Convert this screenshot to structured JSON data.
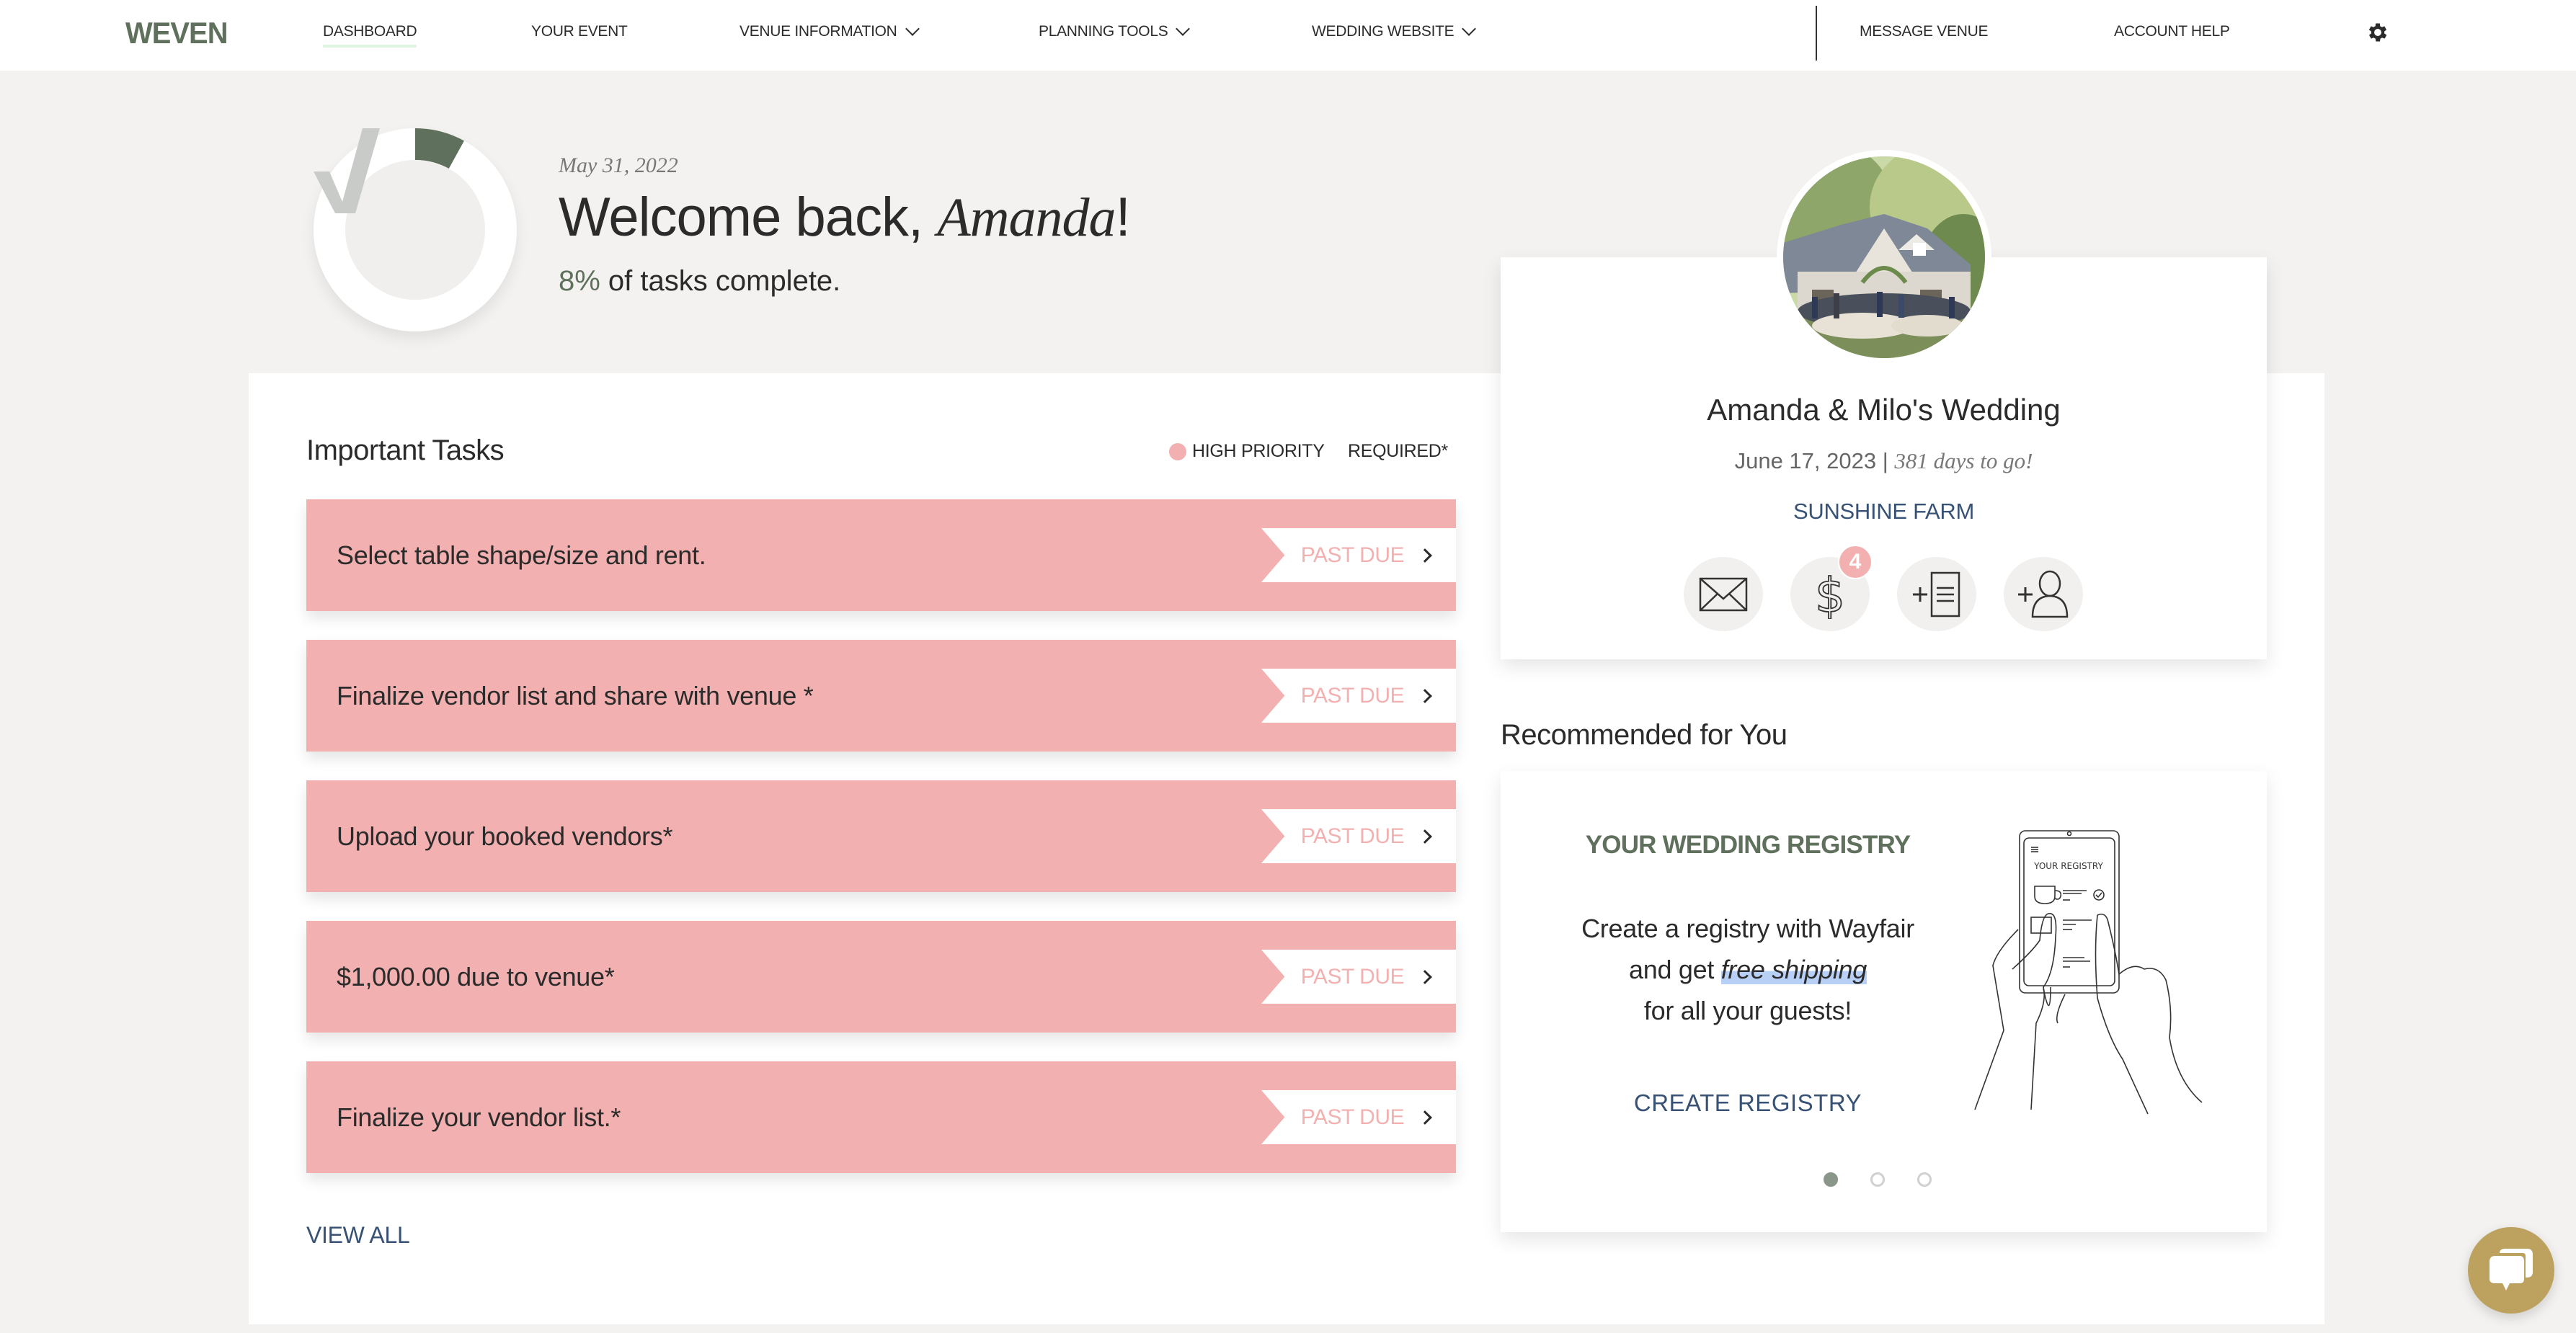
{
  "nav": {
    "logo": "WEVEN",
    "items": [
      {
        "label": "DASHBOARD",
        "active": true,
        "dropdown": false
      },
      {
        "label": "YOUR EVENT",
        "active": false,
        "dropdown": false
      },
      {
        "label": "VENUE INFORMATION",
        "active": false,
        "dropdown": true
      },
      {
        "label": "PLANNING TOOLS",
        "active": false,
        "dropdown": true
      },
      {
        "label": "WEDDING WEBSITE",
        "active": false,
        "dropdown": true
      }
    ],
    "right_items": [
      {
        "label": "MESSAGE VENUE"
      },
      {
        "label": "ACCOUNT HELP"
      }
    ],
    "settings_icon": "gear-icon"
  },
  "welcome": {
    "date": "May 31, 2022",
    "greeting": "Welcome back, ",
    "name": "Amanda",
    "exclaim": "!",
    "percent_label": "8%",
    "percent_value": 8,
    "percent_suffix": " of tasks complete."
  },
  "tasks": {
    "title": "Important Tasks",
    "legend": {
      "high_priority": "HIGH PRIORITY",
      "required": "REQUIRED*"
    },
    "items": [
      {
        "text": "Select table shape/size and rent.",
        "status": "PAST DUE"
      },
      {
        "text": "Finalize vendor list and share with venue *",
        "status": "PAST DUE"
      },
      {
        "text": "Upload your booked vendors*",
        "status": "PAST DUE"
      },
      {
        "text": "$1,000.00 due to venue*",
        "status": "PAST DUE"
      },
      {
        "text": "Finalize your vendor list.*",
        "status": "PAST DUE"
      }
    ],
    "view_all": "VIEW ALL"
  },
  "event": {
    "title": "Amanda & Milo's Wedding",
    "date": "June 17, 2023",
    "separator": " | ",
    "countdown": "381 days to go!",
    "venue": "SUNSHINE FARM",
    "payment_badge_count": "4",
    "actions": [
      {
        "icon": "envelope-icon"
      },
      {
        "icon": "dollar-icon"
      },
      {
        "icon": "add-document-icon"
      },
      {
        "icon": "add-person-icon"
      }
    ]
  },
  "recommended": {
    "title": "Recommended for You",
    "heading": "YOUR WEDDING REGISTRY",
    "body_line1": "Create a registry with Wayfair",
    "body_line2_pre": "and get ",
    "body_line2_em": "free shipping",
    "body_line3": "for all your guests!",
    "cta": "CREATE REGISTRY",
    "illustration_text": "YOUR REGISTRY",
    "carousel": {
      "total": 3,
      "active": 1
    }
  },
  "colors": {
    "brand_green": "#5f705c",
    "priority_pink": "#f2b1b0",
    "link_blue": "#375274",
    "chat_gold": "#bda25f",
    "background": "#f3f2f0"
  }
}
